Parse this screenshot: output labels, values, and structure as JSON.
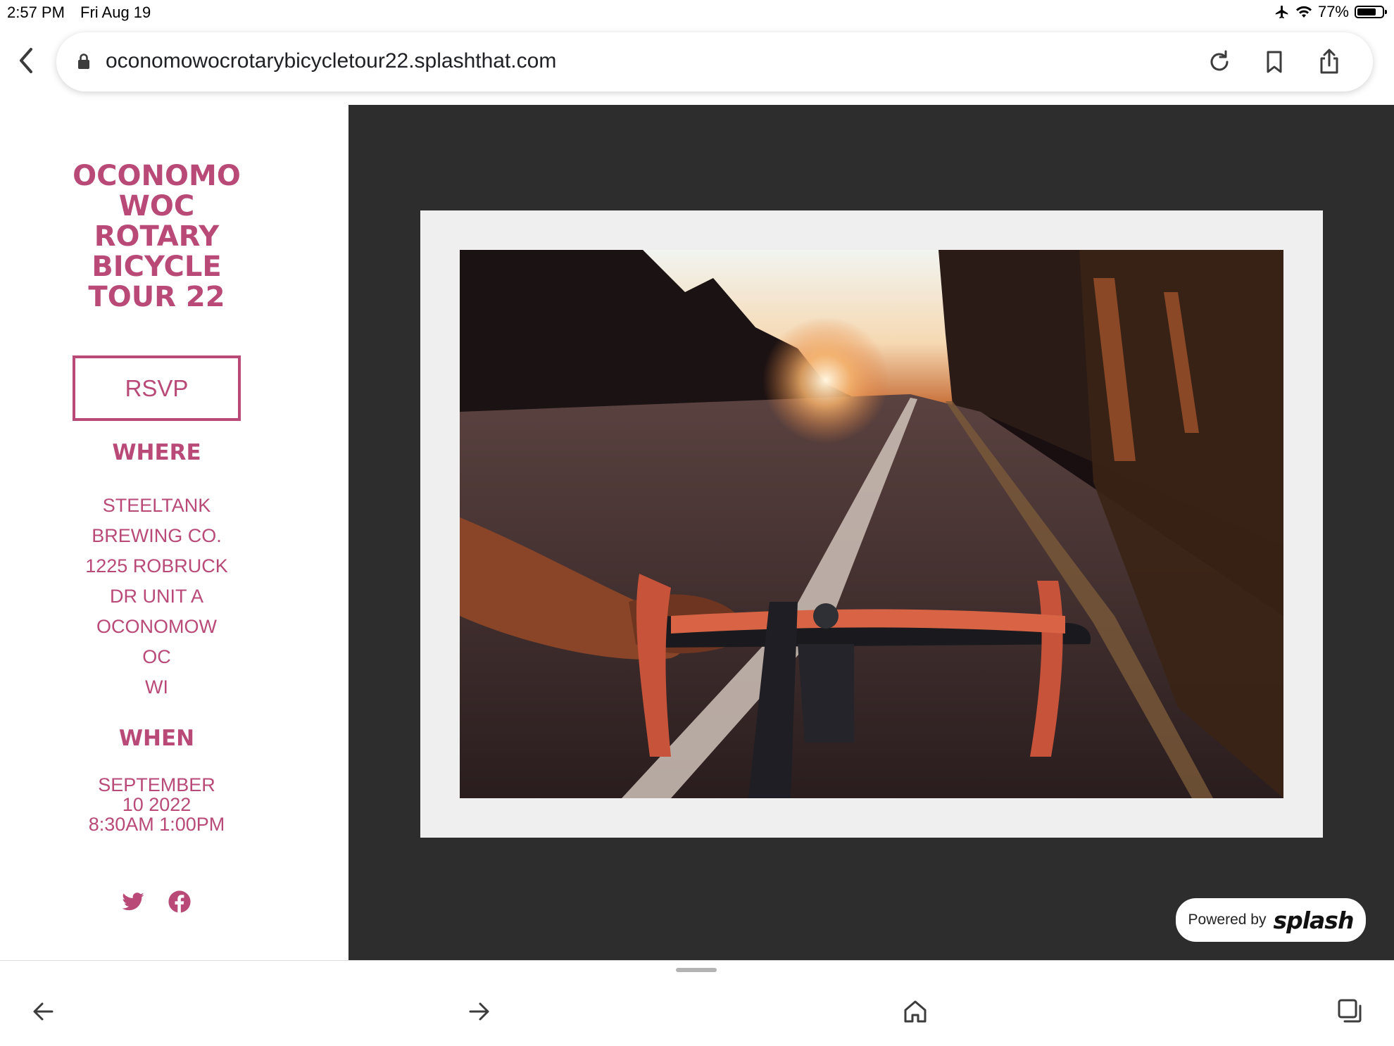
{
  "status_bar": {
    "time": "2:57 PM",
    "date": "Fri Aug 19",
    "battery": "77%",
    "battery_level": 0.77
  },
  "browser": {
    "url": "oconomowocrotarybicycletour22.splashthat.com"
  },
  "event": {
    "title": "OCONOMO WOC ROTARY BICYCLE TOUR 22",
    "rsvp_label": "RSVP",
    "where_heading": "WHERE",
    "where_lines": [
      "STEELTANK",
      "BREWING CO.",
      "1225 ROBRUCK",
      "DR UNIT A",
      "OCONOMOW",
      "OC",
      "WI"
    ],
    "when_heading": "WHEN",
    "when_lines": [
      "SEPTEMBER",
      "10 2022",
      "8:30AM 1:00PM"
    ]
  },
  "badge": {
    "powered_by": "Powered by",
    "brand": "splash"
  },
  "colors": {
    "accent": "#b94a78",
    "dark_bg": "#2d2d2d",
    "frame": "#efefef"
  },
  "icons": [
    "back-icon",
    "lock-icon",
    "reload-icon",
    "bookmark-icon",
    "share-icon",
    "twitter-icon",
    "facebook-icon",
    "arrow-left-icon",
    "arrow-right-icon",
    "home-icon",
    "tabs-icon"
  ]
}
